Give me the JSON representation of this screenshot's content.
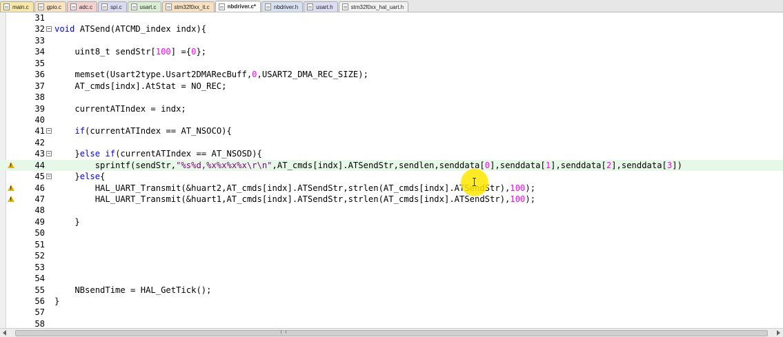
{
  "tabs": [
    {
      "label": "main.c",
      "color": "#f8e8a8",
      "active": false
    },
    {
      "label": "gpio.c",
      "color": "#fbe3bf",
      "active": false
    },
    {
      "label": "adc.c",
      "color": "#f3d1d1",
      "active": false
    },
    {
      "label": "spi.c",
      "color": "#d9dbf3",
      "active": false
    },
    {
      "label": "usart.c",
      "color": "#d9eed2",
      "active": false
    },
    {
      "label": "stm32f0xx_it.c",
      "color": "#f7e1c1",
      "active": false
    },
    {
      "label": "nbdriver.c*",
      "color": "#ffffff",
      "active": true
    },
    {
      "label": "nbdriver.h",
      "color": "#d6e1f1",
      "active": false
    },
    {
      "label": "usart.h",
      "color": "#dcdcf3",
      "active": false
    },
    {
      "label": "stm32f0xx_hal_uart.h",
      "color": "#f2f2f2",
      "active": false
    }
  ],
  "lines": [
    {
      "num": "31",
      "code": ""
    },
    {
      "num": "32",
      "code": "void ATSend(ATCMD_index indx){",
      "fold": "−"
    },
    {
      "num": "33",
      "code": ""
    },
    {
      "num": "34",
      "code": "    uint8_t sendStr[100] ={0};"
    },
    {
      "num": "35",
      "code": ""
    },
    {
      "num": "36",
      "code": "    memset(Usart2type.Usart2DMARecBuff,0,USART2_DMA_REC_SIZE);"
    },
    {
      "num": "37",
      "code": "    AT_cmds[indx].AtStat = NO_REC;"
    },
    {
      "num": "38",
      "code": ""
    },
    {
      "num": "39",
      "code": "    currentATIndex = indx;"
    },
    {
      "num": "40",
      "code": ""
    },
    {
      "num": "41",
      "code": "    if(currentATIndex == AT_NSOCO){",
      "fold": "−"
    },
    {
      "num": "42",
      "code": ""
    },
    {
      "num": "43",
      "code": "    }else if(currentATIndex == AT_NSOSD){",
      "fold": "−"
    },
    {
      "num": "44",
      "code": "        sprintf(sendStr,\"%s%d,%x%x%x%x\\r\\n\",AT_cmds[indx].ATSendStr,sendlen,senddata[0],senddata[1],senddata[2],senddata[3])",
      "warn": true,
      "highlight": true
    },
    {
      "num": "45",
      "code": "    }else{",
      "fold": "−"
    },
    {
      "num": "46",
      "code": "        HAL_UART_Transmit(&huart2,AT_cmds[indx].ATSendStr,strlen(AT_cmds[indx].ATSendStr),100);",
      "warn": true
    },
    {
      "num": "47",
      "code": "        HAL_UART_Transmit(&huart1,AT_cmds[indx].ATSendStr,strlen(AT_cmds[indx].ATSendStr),100);",
      "warn": true
    },
    {
      "num": "48",
      "code": ""
    },
    {
      "num": "49",
      "code": "    }"
    },
    {
      "num": "50",
      "code": ""
    },
    {
      "num": "51",
      "code": ""
    },
    {
      "num": "52",
      "code": ""
    },
    {
      "num": "53",
      "code": ""
    },
    {
      "num": "54",
      "code": ""
    },
    {
      "num": "55",
      "code": "    NBsendTime = HAL_GetTick();"
    },
    {
      "num": "56",
      "code": "}"
    },
    {
      "num": "57",
      "code": ""
    },
    {
      "num": "58",
      "code": ""
    }
  ],
  "colors": {
    "keyword": "#0000ff",
    "number": "#ff00ff",
    "string": "#7d007d",
    "highlight_line": "#e8f8e8",
    "warning": "#e3b300"
  }
}
